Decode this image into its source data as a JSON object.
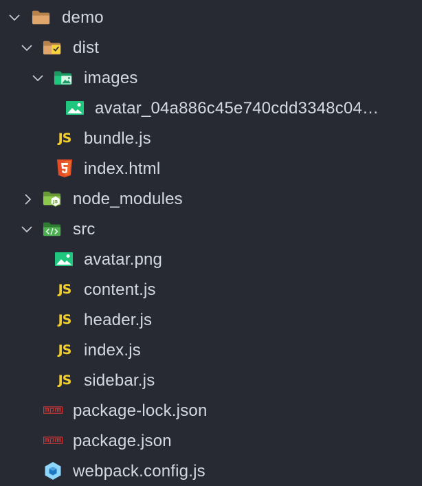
{
  "explorer": {
    "items": [
      {
        "label": "demo",
        "type": "folder-open",
        "icon": "folder-open-icon"
      },
      {
        "label": "dist",
        "type": "folder-dist-open",
        "icon": "folder-dist-icon"
      },
      {
        "label": "images",
        "type": "folder-images-open",
        "icon": "folder-images-icon"
      },
      {
        "label": "avatar_04a886c45e740cdd3348c04…",
        "type": "image-file",
        "icon": "image-file-icon"
      },
      {
        "label": "bundle.js",
        "type": "js-file",
        "icon": "js-file-icon"
      },
      {
        "label": "index.html",
        "type": "html-file",
        "icon": "html5-icon"
      },
      {
        "label": "node_modules",
        "type": "folder-node-collapsed",
        "icon": "folder-node-icon"
      },
      {
        "label": "src",
        "type": "folder-src-open",
        "icon": "folder-src-icon"
      },
      {
        "label": "avatar.png",
        "type": "image-file",
        "icon": "image-file-icon"
      },
      {
        "label": "content.js",
        "type": "js-file",
        "icon": "js-file-icon"
      },
      {
        "label": "header.js",
        "type": "js-file",
        "icon": "js-file-icon"
      },
      {
        "label": "index.js",
        "type": "js-file",
        "icon": "js-file-icon"
      },
      {
        "label": "sidebar.js",
        "type": "js-file",
        "icon": "js-file-icon"
      },
      {
        "label": "package-lock.json",
        "type": "npm-file",
        "icon": "npm-icon"
      },
      {
        "label": "package.json",
        "type": "npm-file",
        "icon": "npm-icon"
      },
      {
        "label": "webpack.config.js",
        "type": "webpack-file",
        "icon": "webpack-icon"
      }
    ],
    "icon_text": {
      "js": "JS",
      "npm": "npm",
      "html": "5"
    }
  },
  "colors": {
    "background": "#272a33",
    "text": "#d4d8e0",
    "chevron": "#c5c9d1",
    "js": "#f4cf2b",
    "html": "#e44d26",
    "image": "#1fc77e",
    "npm": "#cb3837",
    "webpack": "#8ed6fb",
    "folder": "#e0a66b",
    "node": "#8cc84b",
    "src": "#4caf50"
  }
}
